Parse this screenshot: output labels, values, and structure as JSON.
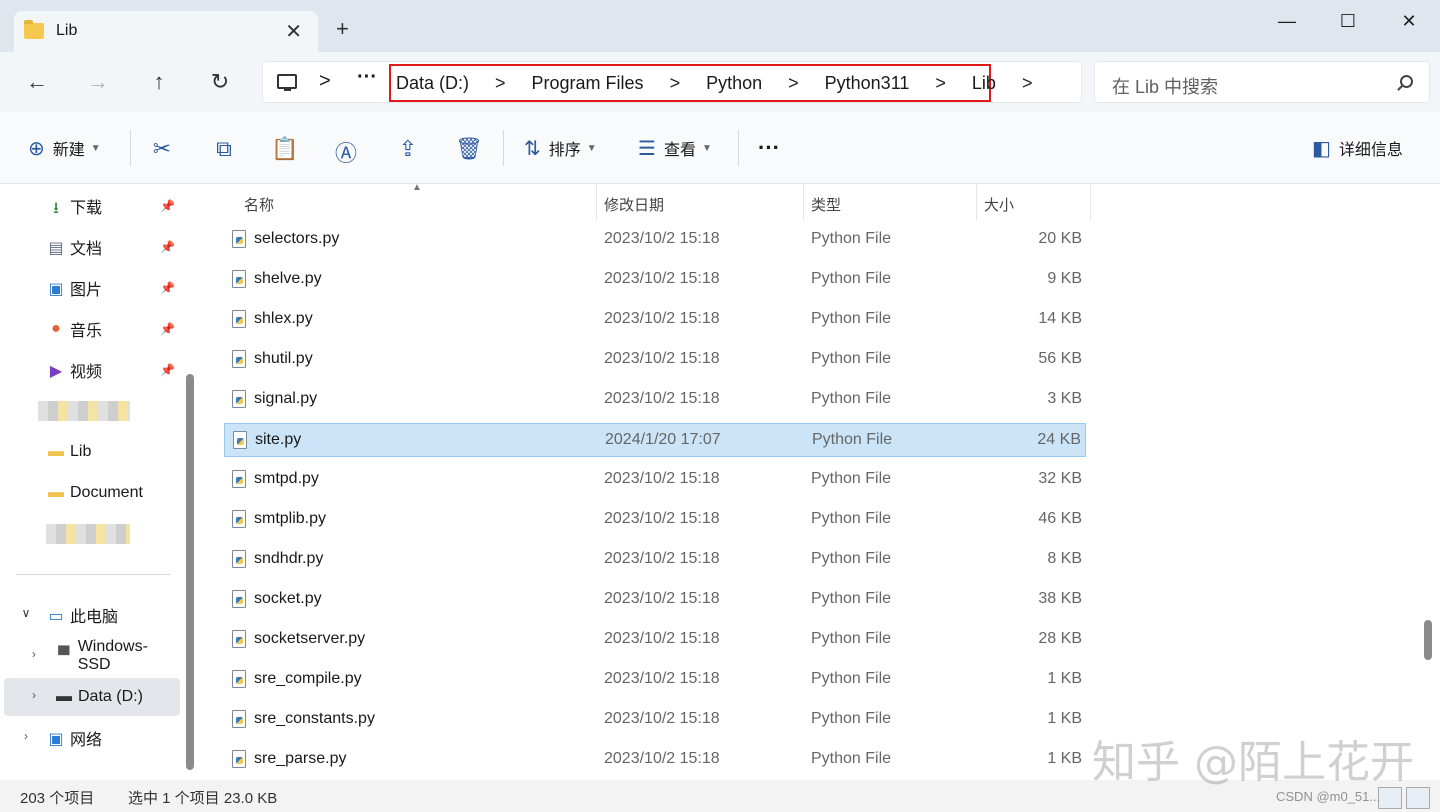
{
  "tab": {
    "title": "Lib"
  },
  "window": {
    "new_tab": "+",
    "minimize": "—",
    "maximize": "☐",
    "close": "✕"
  },
  "nav": {
    "back": "←",
    "forward": "→",
    "up": "↑",
    "refresh": "↻",
    "more": "···",
    "sep": ">"
  },
  "breadcrumbs": [
    "Data (D:)",
    "Program Files",
    "Python",
    "Python311",
    "Lib"
  ],
  "search": {
    "placeholder": "在 Lib 中搜索"
  },
  "toolbar": {
    "new_label": "新建",
    "sort_label": "排序",
    "view_label": "查看",
    "more_label": "···",
    "details_label": "详细信息"
  },
  "sidebar": {
    "quick_access": [
      {
        "label": "下载",
        "icon": "download-icon"
      },
      {
        "label": "文档",
        "icon": "document-icon"
      },
      {
        "label": "图片",
        "icon": "picture-icon"
      },
      {
        "label": "音乐",
        "icon": "music-icon"
      },
      {
        "label": "视频",
        "icon": "video-icon"
      }
    ],
    "folders": [
      "Lib",
      "Document"
    ],
    "this_pc": "此电脑",
    "drives": [
      "Windows-SSD",
      "Data (D:)"
    ],
    "network": "网络"
  },
  "columns": {
    "name": "名称",
    "date": "修改日期",
    "type": "类型",
    "size": "大小"
  },
  "files": [
    {
      "name": "selectors.py",
      "date": "2023/10/2 15:18",
      "type": "Python File",
      "size": "20 KB"
    },
    {
      "name": "shelve.py",
      "date": "2023/10/2 15:18",
      "type": "Python File",
      "size": "9 KB"
    },
    {
      "name": "shlex.py",
      "date": "2023/10/2 15:18",
      "type": "Python File",
      "size": "14 KB"
    },
    {
      "name": "shutil.py",
      "date": "2023/10/2 15:18",
      "type": "Python File",
      "size": "56 KB"
    },
    {
      "name": "signal.py",
      "date": "2023/10/2 15:18",
      "type": "Python File",
      "size": "3 KB"
    },
    {
      "name": "site.py",
      "date": "2024/1/20 17:07",
      "type": "Python File",
      "size": "24 KB",
      "selected": true
    },
    {
      "name": "smtpd.py",
      "date": "2023/10/2 15:18",
      "type": "Python File",
      "size": "32 KB"
    },
    {
      "name": "smtplib.py",
      "date": "2023/10/2 15:18",
      "type": "Python File",
      "size": "46 KB"
    },
    {
      "name": "sndhdr.py",
      "date": "2023/10/2 15:18",
      "type": "Python File",
      "size": "8 KB"
    },
    {
      "name": "socket.py",
      "date": "2023/10/2 15:18",
      "type": "Python File",
      "size": "38 KB"
    },
    {
      "name": "socketserver.py",
      "date": "2023/10/2 15:18",
      "type": "Python File",
      "size": "28 KB"
    },
    {
      "name": "sre_compile.py",
      "date": "2023/10/2 15:18",
      "type": "Python File",
      "size": "1 KB"
    },
    {
      "name": "sre_constants.py",
      "date": "2023/10/2 15:18",
      "type": "Python File",
      "size": "1 KB"
    },
    {
      "name": "sre_parse.py",
      "date": "2023/10/2 15:18",
      "type": "Python File",
      "size": "1 KB"
    }
  ],
  "status": {
    "count": "203 个项目",
    "selection": "选中 1 个项目  23.0 KB"
  },
  "watermark": {
    "big": "知乎 @陌上花开",
    "small": "CSDN @m0_51..."
  },
  "colors": {
    "accent": "#2c5aa0",
    "selection": "#cce4f7",
    "highlight_box": "#e0191b"
  }
}
